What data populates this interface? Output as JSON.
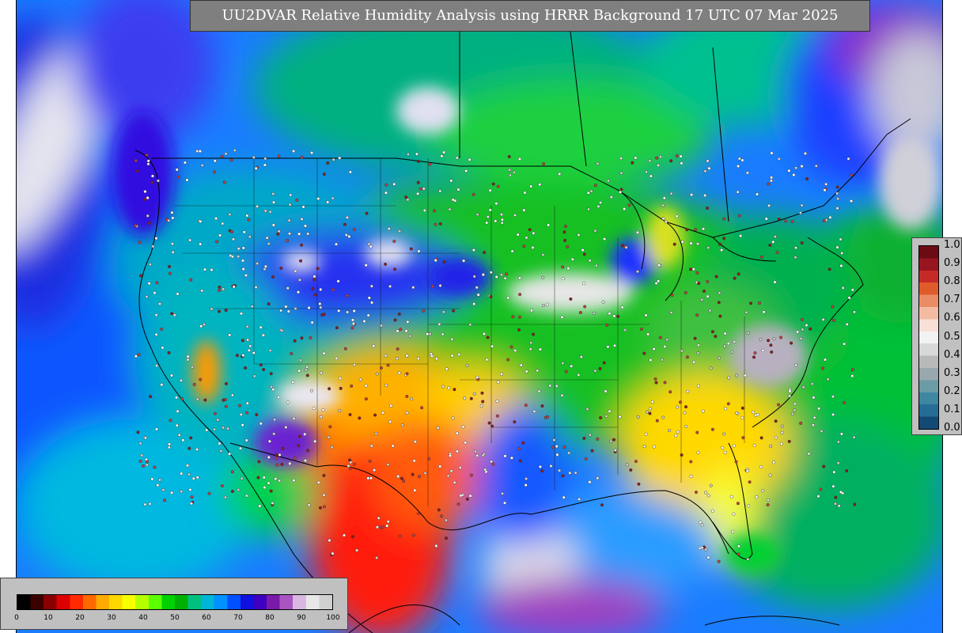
{
  "title": "UU2DVAR Relative Humidity Analysis using HRRR Background 17 UTC 07 Mar 2025",
  "colorbars": {
    "vertical": {
      "labels": [
        "1.0",
        "0.9",
        "0.8",
        "0.7",
        "0.6",
        "0.5",
        "0.4",
        "0.3",
        "0.2",
        "0.1",
        "0.0"
      ],
      "colors": [
        "#6b0c14",
        "#98151f",
        "#c62a27",
        "#e05a2c",
        "#eb8d64",
        "#f4bba3",
        "#f8e0d6",
        "#f2f2f2",
        "#d8d8d8",
        "#b9b9b9",
        "#98a8ac",
        "#6b9ca5",
        "#3f86a0",
        "#256d96",
        "#124a74"
      ]
    },
    "horizontal": {
      "labels": [
        "0",
        "10",
        "20",
        "30",
        "40",
        "50",
        "60",
        "70",
        "80",
        "90",
        "100"
      ],
      "colors": [
        "#000000",
        "#3b0000",
        "#8a0000",
        "#dd0000",
        "#ff2a00",
        "#ff6a00",
        "#ffaa00",
        "#ffd700",
        "#f7ff00",
        "#b4ff00",
        "#5cff00",
        "#00d100",
        "#00b000",
        "#00c080",
        "#00b5d8",
        "#0090ff",
        "#0050ff",
        "#1010e0",
        "#4000c0",
        "#7a1aa8",
        "#a855c0",
        "#d8b8e0",
        "#e8e8e8",
        "#d0d0d0"
      ]
    }
  }
}
